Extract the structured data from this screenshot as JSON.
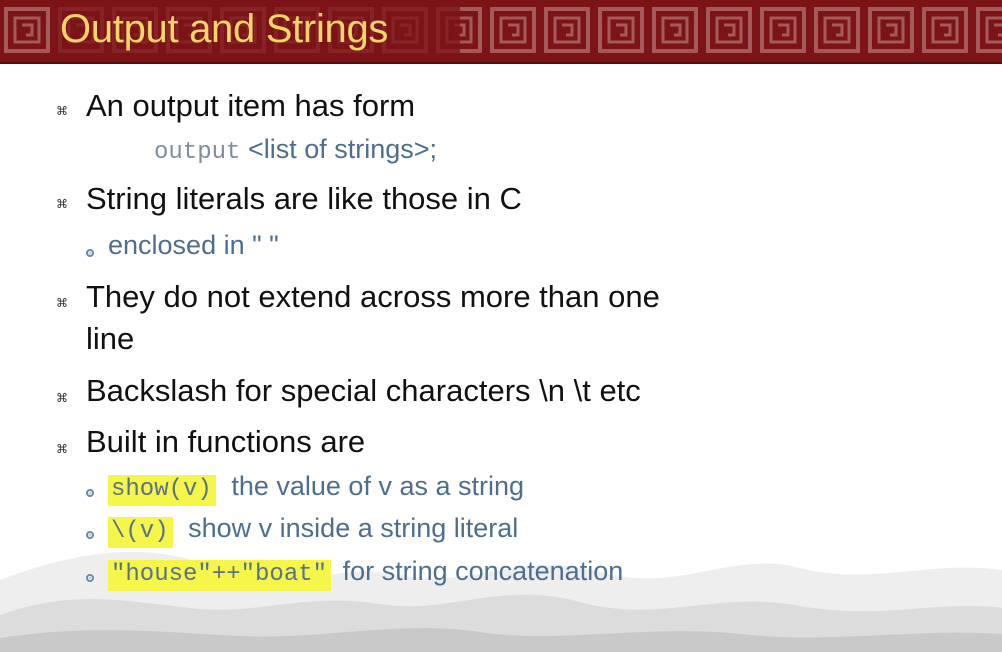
{
  "slide": {
    "title": "Output and Strings",
    "bullets": [
      {
        "text": "An output item has form",
        "sub_code": "output",
        "sub_text": "<list of strings>;"
      },
      {
        "text": "String literals are like those in C",
        "sub_bullet": "enclosed in \"  \""
      },
      {
        "text_line1": "They do not extend across more than one",
        "text_line2": "line"
      },
      {
        "text": "Backslash for special characters \\n \\t etc"
      },
      {
        "text": "Built in functions are",
        "subs": [
          {
            "code": "show(v)",
            "desc": "the value of v as a string"
          },
          {
            "code": "\\(v)",
            "desc": "show v inside a string literal"
          },
          {
            "code": "\"house\"++\"boat\"",
            "desc": "for string concatenation"
          }
        ]
      }
    ]
  },
  "icons": {
    "level1_bullet": "command-key-icon",
    "level2_bullet": "ring-dot-icon"
  },
  "colors": {
    "banner": "#7c1417",
    "title": "#f3d66a",
    "body_text": "#111111",
    "sub_text": "#4e6e8e",
    "highlight": "#f6f54a"
  }
}
